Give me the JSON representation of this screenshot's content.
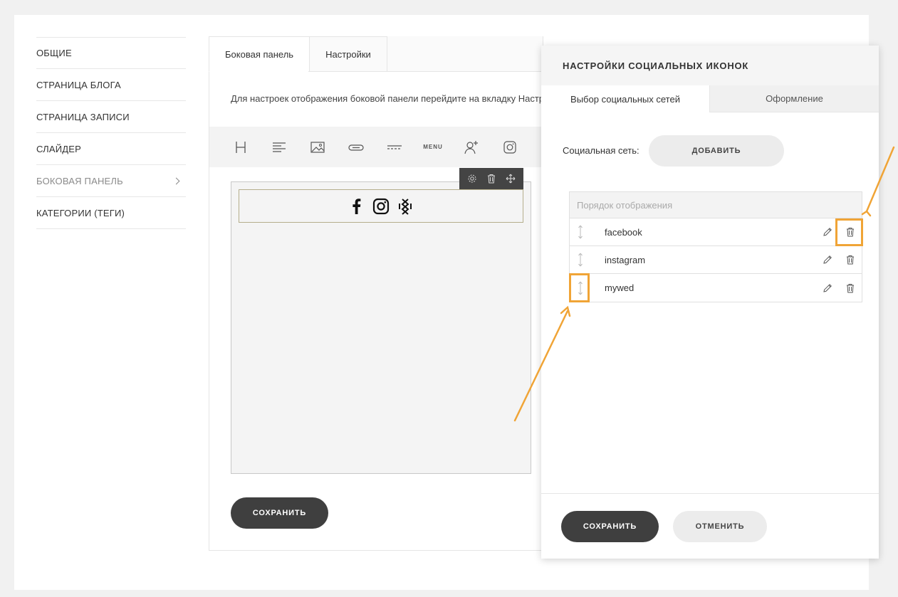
{
  "sidebar": {
    "items": [
      {
        "label": "ОБЩИЕ"
      },
      {
        "label": "СТРАНИЦА БЛОГА"
      },
      {
        "label": "СТРАНИЦА ЗАПИСИ"
      },
      {
        "label": "СЛАЙДЕР"
      },
      {
        "label": "БОКОВАЯ ПАНЕЛЬ",
        "active": true
      },
      {
        "label": "КАТЕГОРИИ (ТЕГИ)"
      }
    ]
  },
  "editor": {
    "tabs": [
      {
        "label": "Боковая панель",
        "active": true
      },
      {
        "label": "Настройки"
      }
    ],
    "hint": "Для настроек отображения боковой панели перейдите на вкладку Настройки",
    "toolbar": {
      "items": [
        "heading-icon",
        "text-icon",
        "image-icon",
        "button-icon",
        "divider-icon",
        "menu-icon",
        "subscribe-icon",
        "instagram-icon"
      ],
      "menu_label": "MENU"
    },
    "widget_icons": [
      "facebook-icon",
      "instagram-icon",
      "mywed-icon"
    ],
    "save_label": "СОХРАНИТЬ"
  },
  "modal": {
    "title": "НАСТРОЙКИ СОЦИАЛЬНЫХ ИКОНОК",
    "tabs": [
      {
        "label": "Выбор социальных сетей",
        "active": true
      },
      {
        "label": "Оформление"
      }
    ],
    "network_label": "Социальная сеть:",
    "add_label": "ДОБАВИТЬ",
    "list_header": "Порядок отображения",
    "networks": [
      {
        "name": "facebook"
      },
      {
        "name": "instagram"
      },
      {
        "name": "mywed"
      }
    ],
    "save_label": "СОХРАНИТЬ",
    "cancel_label": "ОТМЕНИТЬ"
  },
  "colors": {
    "accent": "#f0a436",
    "dark_button": "#3f3f3f",
    "light_button": "#ececec"
  }
}
